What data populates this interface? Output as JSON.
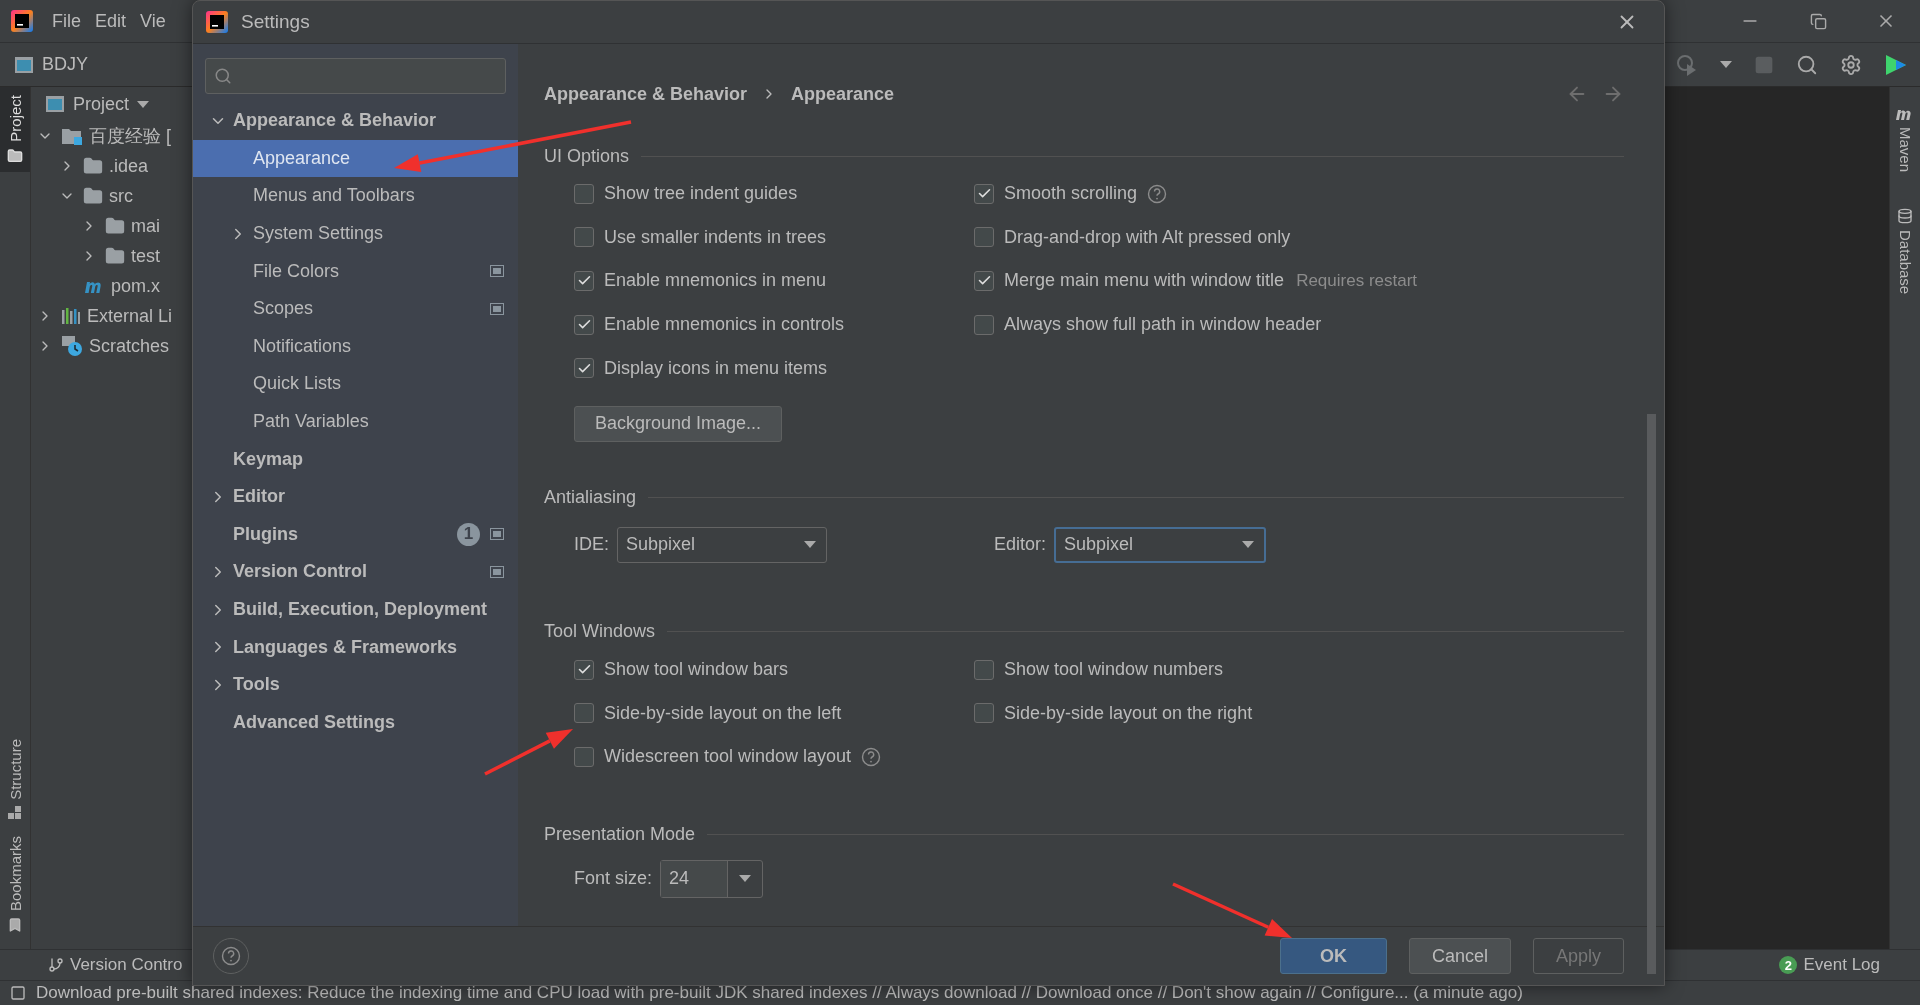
{
  "ide": {
    "menu": [
      "File",
      "Edit",
      "Vie"
    ],
    "project_name": "BDJY",
    "panel_title": "Project",
    "tree": [
      {
        "label": "百度经验 [",
        "kind": "module",
        "expanded": true,
        "children": [
          {
            "label": ".idea",
            "kind": "folder",
            "expanded": false
          },
          {
            "label": "src",
            "kind": "folder",
            "expanded": true,
            "children": [
              {
                "label": "mai",
                "kind": "folder",
                "expanded": false
              },
              {
                "label": "test",
                "kind": "folder",
                "expanded": false
              }
            ]
          },
          {
            "label": "pom.x",
            "kind": "maven"
          }
        ]
      },
      {
        "label": "External Li",
        "kind": "libraries",
        "expanded": false
      },
      {
        "label": "Scratches",
        "kind": "scratches",
        "expanded": false
      }
    ],
    "left_tabs": [
      {
        "label": "Project",
        "selected": true,
        "kind": "project"
      }
    ],
    "left_bottom_tabs": [
      {
        "label": "Structure",
        "kind": "structure"
      },
      {
        "label": "Bookmarks",
        "kind": "bookmarks"
      }
    ],
    "right_tabs": [
      {
        "label": "Maven",
        "kind": "maven"
      },
      {
        "label": "Database",
        "kind": "database"
      }
    ],
    "bottom_tab": "Version Contro",
    "event_log": {
      "count": "2",
      "label": "Event Log"
    },
    "status": "Download pre-built shared indexes: Reduce the indexing time and CPU load with pre-built JDK shared indexes // Always download // Download once // Don't show again // Configure... (a minute ago)"
  },
  "dialog": {
    "title": "Settings",
    "sidebar": [
      {
        "label": "Appearance & Behavior",
        "expanded": true,
        "selected": false,
        "children": [
          {
            "label": "Appearance",
            "selected": true
          },
          {
            "label": "Menus and Toolbars",
            "selected": false
          },
          {
            "label": "System Settings",
            "expanded": false,
            "selected": false
          },
          {
            "label": "File Colors",
            "selected": false,
            "project_level": true
          },
          {
            "label": "Scopes",
            "selected": false,
            "project_level": true
          },
          {
            "label": "Notifications",
            "selected": false
          },
          {
            "label": "Quick Lists",
            "selected": false
          },
          {
            "label": "Path Variables",
            "selected": false
          }
        ]
      },
      {
        "label": "Keymap",
        "selected": false
      },
      {
        "label": "Editor",
        "expanded": false,
        "selected": false
      },
      {
        "label": "Plugins",
        "selected": false,
        "badge": "1",
        "project_level": true
      },
      {
        "label": "Version Control",
        "expanded": false,
        "selected": false,
        "project_level": true
      },
      {
        "label": "Build, Execution, Deployment",
        "expanded": false,
        "selected": false
      },
      {
        "label": "Languages & Frameworks",
        "expanded": false,
        "selected": false
      },
      {
        "label": "Tools",
        "expanded": false,
        "selected": false
      },
      {
        "label": "Advanced Settings",
        "selected": false
      }
    ],
    "breadcrumb": [
      "Appearance & Behavior",
      "Appearance"
    ],
    "sections": [
      {
        "kind": "checkboxes",
        "title": "UI Options",
        "columns": [
          [
            {
              "label": "Show tree indent guides",
              "checked": false
            },
            {
              "label": "Use smaller indents in trees",
              "checked": false
            },
            {
              "label": "Enable mnemonics in menu",
              "checked": true
            },
            {
              "label": "Enable mnemonics in controls",
              "checked": true
            },
            {
              "label": "Display icons in menu items",
              "checked": true
            }
          ],
          [
            {
              "label": "Smooth scrolling",
              "checked": true,
              "help": true
            },
            {
              "label": "Drag-and-drop with Alt pressed only",
              "checked": false
            },
            {
              "label": "Merge main menu with window title",
              "checked": true,
              "note": "Requires restart"
            },
            {
              "label": "Always show full path in window header",
              "checked": false
            }
          ]
        ],
        "button": "Background Image..."
      },
      {
        "kind": "combos",
        "title": "Antialiasing",
        "fields": [
          {
            "label": "IDE:",
            "value": "Subpixel",
            "focused": false
          },
          {
            "label": "Editor:",
            "value": "Subpixel",
            "focused": true
          }
        ]
      },
      {
        "kind": "checkboxes",
        "title": "Tool Windows",
        "columns": [
          [
            {
              "label": "Show tool window bars",
              "checked": true
            },
            {
              "label": "Side-by-side layout on the left",
              "checked": false
            },
            {
              "label": "Widescreen tool window layout",
              "checked": false,
              "help": true
            }
          ],
          [
            {
              "label": "Show tool window numbers",
              "checked": false
            },
            {
              "label": "Side-by-side layout on the right",
              "checked": false
            }
          ]
        ]
      },
      {
        "kind": "font",
        "title": "Presentation Mode",
        "field": {
          "label": "Font size:",
          "value": "24"
        }
      }
    ],
    "buttons": [
      {
        "label": "OK",
        "default": true,
        "disabled": false
      },
      {
        "label": "Cancel",
        "default": false,
        "disabled": false
      },
      {
        "label": "Apply",
        "default": false,
        "disabled": true
      }
    ]
  }
}
